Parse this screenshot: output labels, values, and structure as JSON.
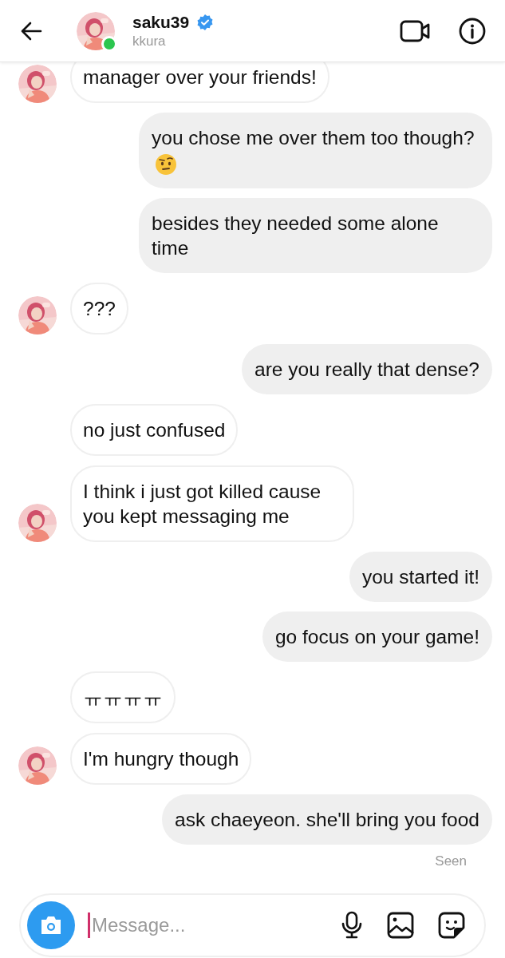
{
  "header": {
    "username": "saku39",
    "verified": true,
    "subtitle": "kkura",
    "online": true
  },
  "messages": [
    {
      "kind": "received",
      "text": "manager over your friends!",
      "avatar": true,
      "cut": true
    },
    {
      "kind": "sent",
      "text": "you chose me over them too though?",
      "emoji": true
    },
    {
      "kind": "sent",
      "text": "besides they needed some alone time"
    },
    {
      "kind": "received",
      "text": "???",
      "avatar": true
    },
    {
      "kind": "sent",
      "text": "are you really that dense?"
    },
    {
      "kind": "received",
      "text": "no just confused",
      "avatar": false
    },
    {
      "kind": "received",
      "text": "I think i just got killed cause you kept messaging me",
      "avatar": true
    },
    {
      "kind": "sent",
      "text": "you started it!"
    },
    {
      "kind": "sent",
      "text": "go focus on your game!"
    },
    {
      "kind": "received",
      "text": "ㅠㅠㅠㅠ",
      "avatar": false
    },
    {
      "kind": "received",
      "text": "I'm hungry though",
      "avatar": true
    },
    {
      "kind": "sent",
      "text": "ask chaeyeon. she'll bring you food"
    }
  ],
  "status": "Seen",
  "composer": {
    "placeholder": "Message..."
  }
}
